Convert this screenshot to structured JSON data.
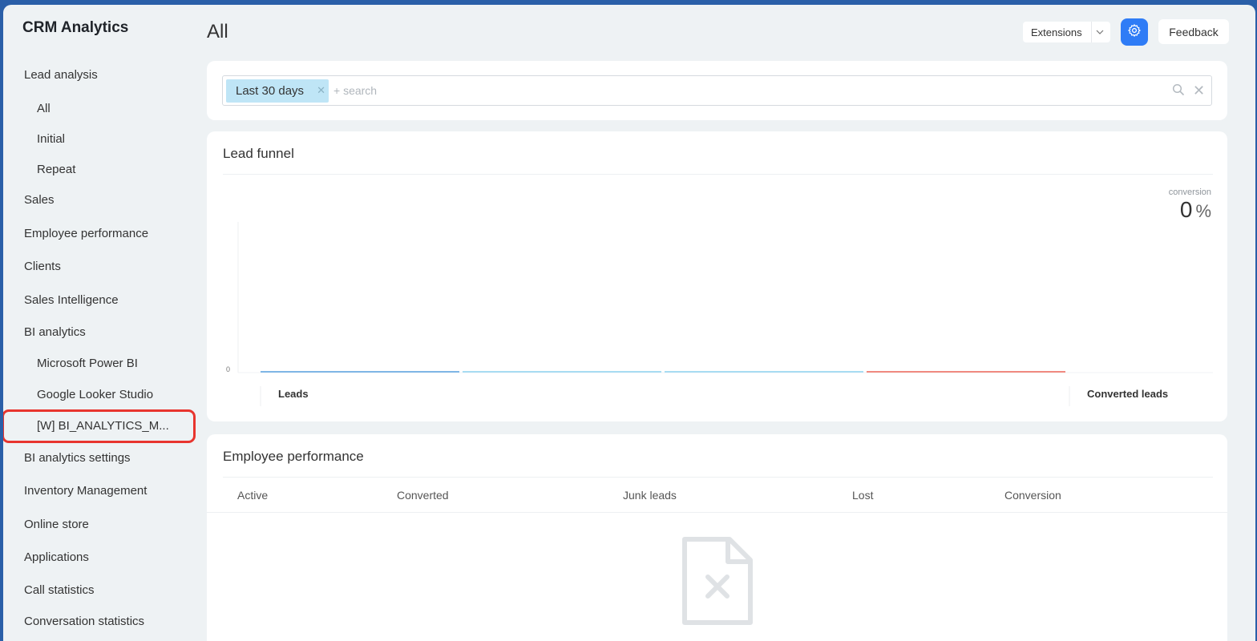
{
  "app": {
    "title": "CRM Analytics"
  },
  "sidebar": {
    "items": [
      {
        "label": "Lead analysis"
      },
      {
        "label": "All"
      },
      {
        "label": "Initial"
      },
      {
        "label": "Repeat"
      },
      {
        "label": "Sales"
      },
      {
        "label": "Employee performance"
      },
      {
        "label": "Clients"
      },
      {
        "label": "Sales Intelligence"
      },
      {
        "label": "BI analytics"
      },
      {
        "label": "Microsoft Power BI"
      },
      {
        "label": "Google Looker Studio"
      },
      {
        "label": "[W] BI_ANALYTICS_M..."
      },
      {
        "label": "BI analytics settings"
      },
      {
        "label": "Inventory Management"
      },
      {
        "label": "Online store"
      },
      {
        "label": "Applications"
      },
      {
        "label": "Call statistics"
      },
      {
        "label": "Conversation statistics"
      }
    ]
  },
  "header": {
    "page_title": "All",
    "extensions_label": "Extensions",
    "settings_icon": "gear-icon",
    "feedback_label": "Feedback"
  },
  "filter": {
    "chip_label": "Last 30 days",
    "search_placeholder": "+ search"
  },
  "funnel": {
    "title": "Lead funnel",
    "conversion_label": "conversion",
    "conversion_value": "0",
    "conversion_unit": "%",
    "y_tick": "0",
    "stage_left": "Leads",
    "stage_right": "Converted leads",
    "segment_colors": [
      "#7fb6e6",
      "#a8dcf2",
      "#a8dcf2",
      "#f08a80"
    ]
  },
  "employee_performance": {
    "title": "Employee performance",
    "columns": [
      "Active",
      "Converted",
      "Junk leads",
      "Lost",
      "Conversion"
    ],
    "empty_icon": "no-data-file-icon"
  },
  "colors": {
    "accent": "#2f7cf6",
    "highlight": "#e8352e",
    "chip_bg": "#bfe5f6"
  }
}
